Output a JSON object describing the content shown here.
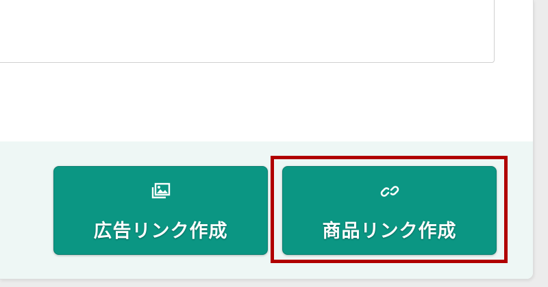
{
  "textarea": {
    "value": ""
  },
  "actions": {
    "ad_link_label": "広告リンク作成",
    "ad_link_icon": "image-gallery-icon",
    "product_link_label": "商品リンク作成",
    "product_link_icon": "link-icon"
  },
  "colors": {
    "button_bg": "#0b9683",
    "footer_bg": "#eef7f5",
    "highlight": "#b00000"
  }
}
